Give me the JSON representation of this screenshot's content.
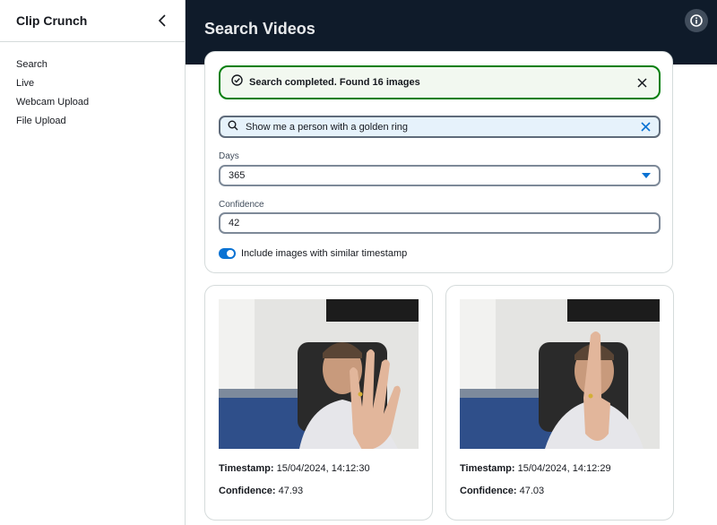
{
  "app": {
    "title": "Clip Crunch"
  },
  "sidebar": {
    "items": [
      {
        "label": "Search"
      },
      {
        "label": "Live"
      },
      {
        "label": "Webcam Upload"
      },
      {
        "label": "File Upload"
      }
    ]
  },
  "header": {
    "title": "Search Videos",
    "info_icon": "info-icon"
  },
  "flash": {
    "message": "Search completed. Found 16 images",
    "icon": "check-circle-icon"
  },
  "search": {
    "value": "Show me a person with a golden ring",
    "icon": "search-icon"
  },
  "days": {
    "label": "Days",
    "value": "365"
  },
  "confidence": {
    "label": "Confidence",
    "value": "42"
  },
  "toggle": {
    "label": "Include images with similar timestamp",
    "on": true
  },
  "results": [
    {
      "timestamp_label": "Timestamp:",
      "timestamp": "15/04/2024, 14:12:30",
      "confidence_label": "Confidence:",
      "confidence": "47.93"
    },
    {
      "timestamp_label": "Timestamp:",
      "timestamp": "15/04/2024, 14:12:29",
      "confidence_label": "Confidence:",
      "confidence": "47.03"
    }
  ],
  "colors": {
    "header_bg": "#0f1b2a",
    "success": "#037f0c",
    "accent": "#0972d3"
  }
}
